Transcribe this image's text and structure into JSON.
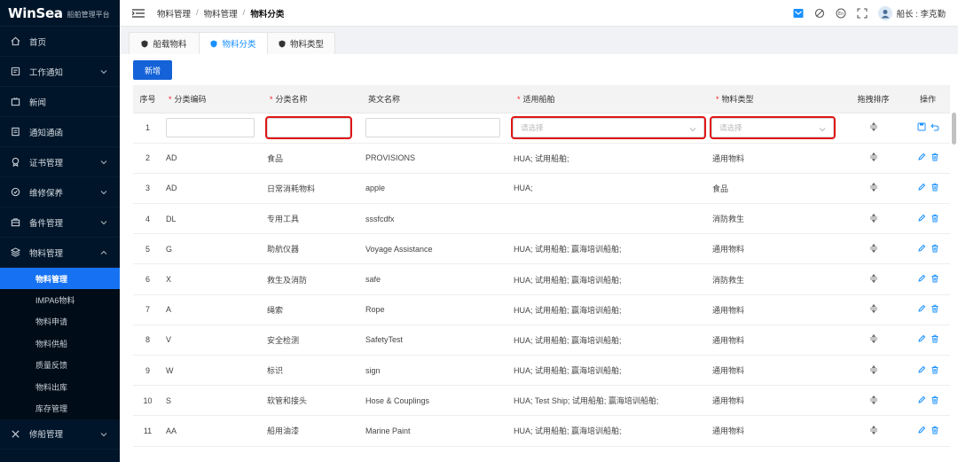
{
  "brand": {
    "logo": "WinSea",
    "subtitle": "船舶管理平台"
  },
  "sidebar": {
    "items": [
      {
        "label": "首页",
        "icon": "home-icon"
      },
      {
        "label": "工作通知",
        "icon": "notice-icon",
        "has_children": true
      },
      {
        "label": "新闻",
        "icon": "news-icon"
      },
      {
        "label": "通知通函",
        "icon": "circular-icon"
      },
      {
        "label": "证书管理",
        "icon": "certificate-icon",
        "has_children": true
      },
      {
        "label": "维修保养",
        "icon": "maintenance-icon",
        "has_children": true
      },
      {
        "label": "备件管理",
        "icon": "spare-parts-icon",
        "has_children": true
      },
      {
        "label": "物料管理",
        "icon": "material-icon",
        "has_children": true,
        "expanded": true
      }
    ],
    "submenu": [
      {
        "label": "物料管理",
        "active": true
      },
      {
        "label": "IMPA6物料"
      },
      {
        "label": "物料申请"
      },
      {
        "label": "物料供船"
      },
      {
        "label": "质量反馈"
      },
      {
        "label": "物料出库"
      },
      {
        "label": "库存管理"
      }
    ],
    "after": {
      "label": "修船管理",
      "icon": "ship-repair-icon",
      "has_children": true
    }
  },
  "header": {
    "breadcrumb": [
      "物料管理",
      "物料管理",
      "物料分类"
    ],
    "user": "船长 : 李克勤"
  },
  "tabs": [
    {
      "label": "船载物料"
    },
    {
      "label": "物料分类",
      "active": true
    },
    {
      "label": "物料类型"
    }
  ],
  "toolbar": {
    "add_label": "新增"
  },
  "table": {
    "columns": {
      "index": "序号",
      "code": "分类编码",
      "name": "分类名称",
      "en_name": "英文名称",
      "ships": "适用船舶",
      "type": "物料类型",
      "sort": "拖拽排序",
      "ops": "操作"
    },
    "required_mark": "*",
    "edit_row": {
      "index": "1",
      "ships_placeholder": "请选择",
      "type_placeholder": "请选择"
    },
    "rows": [
      {
        "index": "2",
        "code": "AD",
        "name": "食品",
        "en_name": "PROVISIONS",
        "ships": "HUA; 试用船舶;",
        "type": "通用物料"
      },
      {
        "index": "3",
        "code": "AD",
        "name": "日常消耗物料",
        "en_name": "apple",
        "ships": "HUA;",
        "type": "食品"
      },
      {
        "index": "4",
        "code": "DL",
        "name": "专用工具",
        "en_name": "sssfcdfx",
        "ships": "",
        "type": "消防救生"
      },
      {
        "index": "5",
        "code": "G",
        "name": "助航仪器",
        "en_name": "Voyage Assistance",
        "ships": "HUA; 试用船舶; 赢海培训船舶;",
        "type": "通用物料"
      },
      {
        "index": "6",
        "code": "X",
        "name": "救生及消防",
        "en_name": "safe",
        "ships": "HUA; 试用船舶; 赢海培训船舶;",
        "type": "消防救生"
      },
      {
        "index": "7",
        "code": "A",
        "name": "绳索",
        "en_name": "Rope",
        "ships": "HUA; 试用船舶; 赢海培训船舶;",
        "type": "通用物料"
      },
      {
        "index": "8",
        "code": "V",
        "name": "安全检测",
        "en_name": "SafetyTest",
        "ships": "HUA; 试用船舶; 赢海培训船舶;",
        "type": "通用物料"
      },
      {
        "index": "9",
        "code": "W",
        "name": "标识",
        "en_name": "sign",
        "ships": "HUA; 试用船舶; 赢海培训船舶;",
        "type": "通用物料"
      },
      {
        "index": "10",
        "code": "S",
        "name": "软管和接头",
        "en_name": "Hose & Couplings",
        "ships": "HUA; Test Ship; 试用船舶; 赢海培训船舶;",
        "type": "通用物料"
      },
      {
        "index": "11",
        "code": "AA",
        "name": "船用油漆",
        "en_name": "Marine Paint",
        "ships": "HUA; 试用船舶; 赢海培训船舶;",
        "type": "通用物料"
      }
    ]
  },
  "colors": {
    "sidebar_bg": "#001529",
    "active_blue": "#1672f3",
    "primary_button": "#1562d8",
    "highlight_red": "#e01515"
  }
}
